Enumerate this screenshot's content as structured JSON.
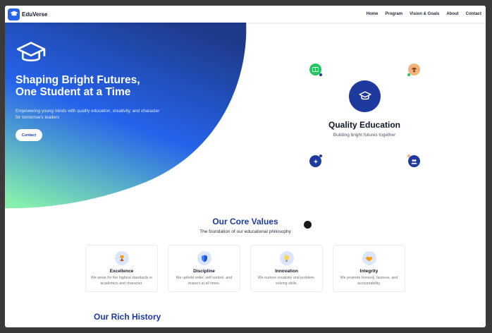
{
  "brand": {
    "name": "EduVerse",
    "logo_icon": "graduation-cap-icon"
  },
  "nav": {
    "items": [
      "Home",
      "Program",
      "Vision & Goals",
      "About",
      "Contact"
    ]
  },
  "hero": {
    "cap_icon": "graduation-cap-icon",
    "title_line1": "Shaping Bright Futures,",
    "title_line2": "One Student at a Time",
    "subtitle": "Empowering young minds with quality education, creativity, and character for tomorrow's leaders",
    "cta_label": "Contact",
    "gradient_colors": [
      "#1e3a8a",
      "#2563eb",
      "#86efac"
    ]
  },
  "quality": {
    "title": "Quality Education",
    "subtitle": "Building bright futures together",
    "center_icon": "graduation-cap-icon",
    "orbit_icons": [
      {
        "name": "book-icon",
        "color": "#22c55e"
      },
      {
        "name": "student-icon",
        "color": "#f2b27a"
      },
      {
        "name": "sparkle-icon",
        "color": "#1e3a9e"
      },
      {
        "name": "group-icon",
        "color": "#1e3a9e"
      }
    ]
  },
  "core_values": {
    "title": "Our Core Values",
    "subtitle": "The foundation of our educational philosophy",
    "cards": [
      {
        "icon": "trophy-icon",
        "title": "Excellence",
        "desc": "We strive for the highest standards in academics and character."
      },
      {
        "icon": "shield-icon",
        "title": "Discipline",
        "desc": "We uphold order, self-control, and respect at all times."
      },
      {
        "icon": "lightbulb-icon",
        "title": "Innovation",
        "desc": "We nurture creativity and problem-solving skills."
      },
      {
        "icon": "handshake-icon",
        "title": "Integrity",
        "desc": "We promote honesty, fairness, and accountability."
      }
    ]
  },
  "history": {
    "title": "Our Rich History"
  },
  "colors": {
    "accent": "#1e3a9e",
    "brand": "#2563eb"
  }
}
